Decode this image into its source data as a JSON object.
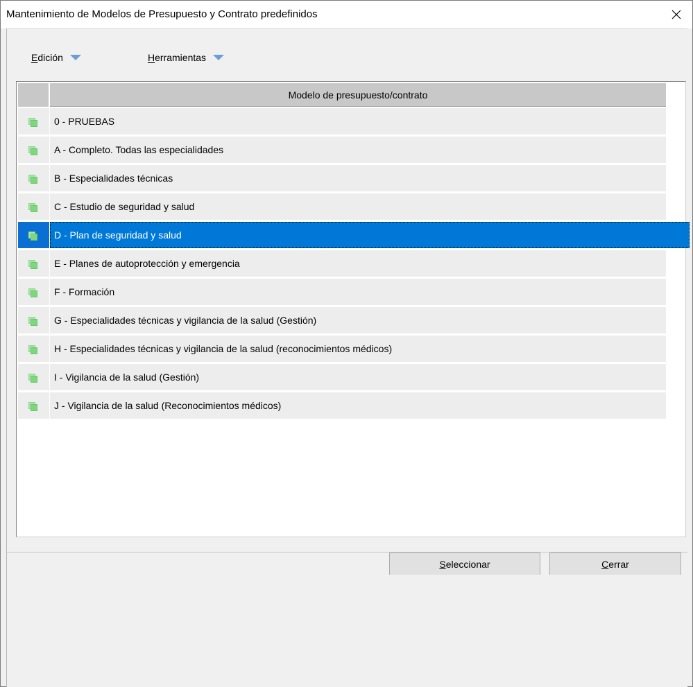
{
  "window": {
    "title": "Mantenimiento de Modelos de Presupuesto y Contrato predefinidos",
    "close_glyph": "✕"
  },
  "menu": [
    {
      "accel": "E",
      "rest": "dición",
      "icon": "dropdown-arrow-icon"
    },
    {
      "accel": "H",
      "rest": "erramientas",
      "icon": "dropdown-arrow-icon"
    }
  ],
  "grid": {
    "column_header": "Modelo de presupuesto/contrato",
    "rows": [
      {
        "label": "0 - PRUEBAS",
        "icon": "model-icon",
        "selected": false
      },
      {
        "label": "A - Completo. Todas las especialidades",
        "icon": "model-icon",
        "selected": false
      },
      {
        "label": "B - Especialidades técnicas",
        "icon": "model-icon",
        "selected": false
      },
      {
        "label": "C - Estudio de seguridad y salud",
        "icon": "model-icon",
        "selected": false
      },
      {
        "label": "D - Plan de seguridad y salud",
        "icon": "model-icon",
        "selected": true
      },
      {
        "label": "E - Planes de autoprotección y emergencia",
        "icon": "model-icon",
        "selected": false
      },
      {
        "label": "F - Formación",
        "icon": "model-icon",
        "selected": false
      },
      {
        "label": "G - Especialidades técnicas y vigilancia de la salud (Gestión)",
        "icon": "model-icon",
        "selected": false
      },
      {
        "label": "H - Especialidades técnicas y vigilancia de la salud (reconocimientos médicos)",
        "icon": "model-icon",
        "selected": false
      },
      {
        "label": "I - Vigilancia de la salud (Gestión)",
        "icon": "model-icon",
        "selected": false
      },
      {
        "label": "J - Vigilancia de la salud (Reconocimientos médicos)",
        "icon": "model-icon",
        "selected": false
      }
    ]
  },
  "buttons": {
    "select": {
      "accel": "S",
      "rest": "eleccionar"
    },
    "close": {
      "accel": "C",
      "rest": "errar"
    }
  },
  "colors": {
    "selection": "#0078d7",
    "row_bg": "#ededed",
    "header_bg": "#c8c8c8",
    "icon_green": "#7fd67f",
    "menu_arrow": "#6b9ed8"
  }
}
